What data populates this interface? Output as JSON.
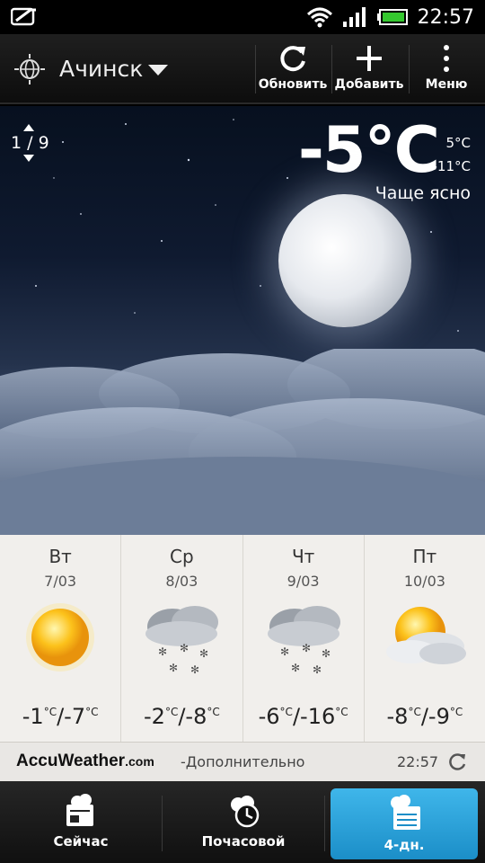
{
  "status_bar": {
    "time": "22:57"
  },
  "action_bar": {
    "city": "Ачинск",
    "refresh_label": "Обновить",
    "add_label": "Добавить",
    "menu_label": "Меню"
  },
  "current": {
    "page_indicator": "1 / 9",
    "temperature": "-5",
    "unit": "°C",
    "high": "5°C",
    "low": "-11°C",
    "condition": "Чаще ясно"
  },
  "forecast": [
    {
      "day": "Вт",
      "date": "7/03",
      "icon": "sunny-icon",
      "high": "-1",
      "low": "-7"
    },
    {
      "day": "Ср",
      "date": "8/03",
      "icon": "snow-icon",
      "high": "-2",
      "low": "-8"
    },
    {
      "day": "Чт",
      "date": "9/03",
      "icon": "snow-icon",
      "high": "-6",
      "low": "-16"
    },
    {
      "day": "Пт",
      "date": "10/03",
      "icon": "partly-sunny-icon",
      "high": "-8",
      "low": "-9"
    }
  ],
  "forecast_unit": "°C",
  "footer": {
    "brand": "AccuWeather",
    "brand_suffix": ".com",
    "more_label": "-Дополнительно",
    "updated_time": "22:57"
  },
  "tabs": [
    {
      "label": "Сейчас",
      "active": false
    },
    {
      "label": "Почасовой",
      "active": false
    },
    {
      "label": "4-дн.",
      "active": true
    }
  ],
  "colors": {
    "active_tab": "#2aa3dc",
    "forecast_bg": "#f1efec"
  }
}
